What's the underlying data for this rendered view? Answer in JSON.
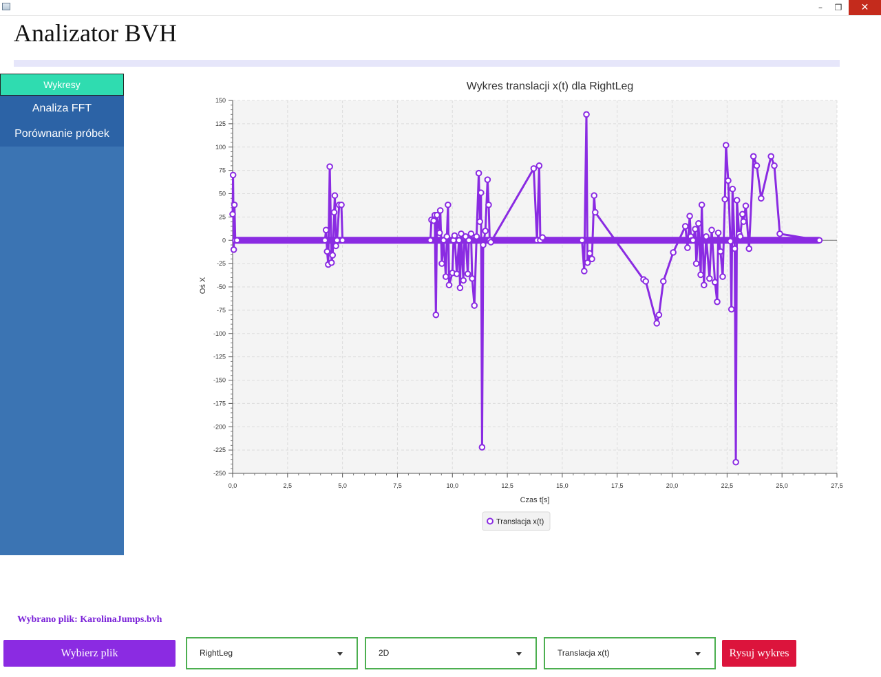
{
  "window": {
    "controls": {
      "minimize": "–",
      "maximize": "❐",
      "close": "✕"
    }
  },
  "app": {
    "title": "Analizator BVH"
  },
  "sidebar": {
    "items": [
      {
        "label": "Wykresy",
        "active": true
      },
      {
        "label": "Analiza FFT",
        "active": false
      },
      {
        "label": "Porównanie próbek",
        "active": false
      }
    ]
  },
  "chart_data": {
    "type": "line",
    "title": "Wykres translacji x(t) dla RightLeg",
    "xlabel": "Czas t[s]",
    "ylabel": "Oś X",
    "xlim": [
      0,
      27.5
    ],
    "ylim": [
      -250,
      150
    ],
    "x_ticks": [
      "0,0",
      "2,5",
      "5,0",
      "7,5",
      "10,0",
      "12,5",
      "15,0",
      "17,5",
      "20,0",
      "22,5",
      "25,0",
      "27,5"
    ],
    "y_ticks": [
      "150",
      "125",
      "100",
      "75",
      "50",
      "25",
      "0",
      "-25",
      "-50",
      "-75",
      "-100",
      "-125",
      "-150",
      "-175",
      "-200",
      "-225",
      "-250"
    ],
    "grid": true,
    "legend_position": "bottom-center",
    "series": [
      {
        "name": "Translacja x(t)",
        "color": "#8a2be2",
        "x": [
          0.0,
          0.02,
          0.05,
          0.08,
          0.12,
          0.2,
          4.2,
          4.25,
          4.3,
          4.35,
          4.42,
          4.5,
          4.55,
          4.62,
          4.65,
          4.7,
          4.75,
          4.85,
          4.95,
          5.0,
          9.0,
          9.05,
          9.15,
          9.2,
          9.25,
          9.3,
          9.42,
          9.45,
          9.52,
          9.6,
          9.7,
          9.75,
          9.8,
          9.85,
          10.0,
          10.05,
          10.1,
          10.2,
          10.3,
          10.35,
          10.4,
          10.5,
          10.55,
          10.6,
          10.7,
          10.75,
          10.85,
          10.9,
          11.0,
          11.1,
          11.2,
          11.25,
          11.3,
          11.35,
          11.4,
          11.5,
          11.6,
          11.65,
          11.7,
          11.75,
          13.7,
          13.85,
          13.95,
          14.0,
          14.1,
          15.9,
          16.0,
          16.1,
          16.15,
          16.25,
          16.35,
          16.45,
          16.5,
          18.7,
          18.8,
          19.3,
          19.4,
          19.6,
          20.05,
          20.6,
          20.7,
          20.8,
          20.85,
          20.9,
          20.95,
          21.05,
          21.1,
          21.2,
          21.3,
          21.35,
          21.45,
          21.55,
          21.7,
          21.8,
          21.95,
          22.05,
          22.1,
          22.2,
          22.3,
          22.4,
          22.45,
          22.55,
          22.65,
          22.7,
          22.75,
          22.85,
          22.9,
          22.95,
          23.05,
          23.1,
          23.2,
          23.25,
          23.35,
          23.5,
          23.7,
          23.85,
          24.05,
          24.5,
          24.65,
          24.9,
          26.7
        ],
        "y": [
          28,
          70,
          -10,
          38,
          0,
          0,
          0,
          11,
          -12,
          -26,
          79,
          -24,
          -16,
          30,
          48,
          -6,
          0,
          38,
          38,
          0,
          0,
          22,
          21,
          27,
          -80,
          27,
          8,
          32,
          -25,
          0,
          -39,
          4,
          38,
          -48,
          -35,
          0,
          5,
          -36,
          0,
          -51,
          7,
          -43,
          3,
          4,
          -36,
          0,
          7,
          -41,
          -70,
          4,
          72,
          20,
          51,
          -222,
          -5,
          10,
          65,
          38,
          0,
          -2,
          77,
          0,
          80,
          0,
          3,
          0,
          -33,
          135,
          -24,
          -14,
          -20,
          48,
          30,
          -42,
          -44,
          -89,
          -80,
          -44,
          -13,
          15,
          -8,
          26,
          4,
          0,
          0,
          12,
          -25,
          18,
          -37,
          38,
          -48,
          4,
          -41,
          11,
          -45,
          -66,
          8,
          -12,
          -39,
          44,
          102,
          64,
          -1,
          -74,
          55,
          -9,
          -238,
          43,
          7,
          4,
          28,
          20,
          37,
          -9,
          90,
          80,
          45,
          90,
          80,
          7,
          0
        ]
      }
    ]
  },
  "footer": {
    "status": "Wybrano plik: KarolinaJumps.bvh",
    "choose_button": "Wybierz plik",
    "bone_select": "RightLeg",
    "mode_select": "2D",
    "type_select": "Translacja x(t)",
    "draw_button": "Rysuj wykres"
  }
}
